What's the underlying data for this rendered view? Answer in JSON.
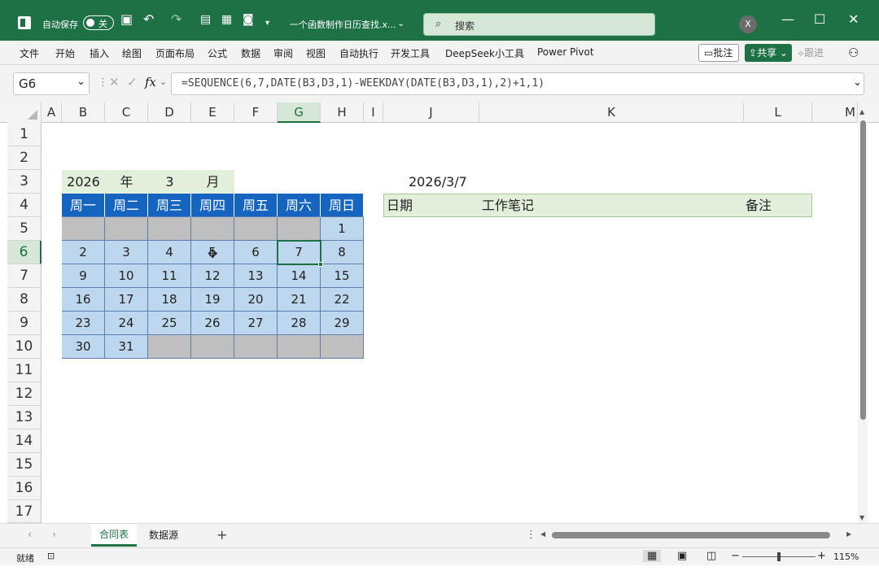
{
  "titlebar": {
    "autosave_label": "自动保存",
    "autosave_state": "关",
    "filename": "一个函数制作日历查找.x...",
    "search_placeholder": "搜索",
    "user_initial": "X"
  },
  "ribbon": {
    "tabs": [
      "文件",
      "开始",
      "插入",
      "绘图",
      "页面布局",
      "公式",
      "数据",
      "审阅",
      "视图",
      "自动执行",
      "开发工具",
      "DeepSeek小工具",
      "Power Pivot"
    ],
    "comment_label": "批注",
    "share_label": "共享",
    "track_label": "跟进"
  },
  "formula_bar": {
    "name_box": "G6",
    "fx_label": "fx",
    "formula": "=SEQUENCE(6,7,DATE(B3,D3,1)-WEEKDAY(DATE(B3,D3,1),2)+1,1)"
  },
  "columns": [
    "A",
    "B",
    "C",
    "D",
    "E",
    "F",
    "G",
    "H",
    "I",
    "J",
    "K",
    "L",
    "M"
  ],
  "selected_column": "G",
  "rows": [
    "1",
    "2",
    "3",
    "4",
    "5",
    "6",
    "7",
    "8",
    "9",
    "10",
    "11",
    "12",
    "13",
    "14",
    "15",
    "16",
    "17"
  ],
  "selected_row": "6",
  "calendar": {
    "year": "2026",
    "year_unit": "年",
    "month": "3",
    "month_unit": "月",
    "weekdays": [
      "周一",
      "周二",
      "周三",
      "周四",
      "周五",
      "周六",
      "周日"
    ],
    "weeks": [
      [
        "",
        "",
        "",
        "",
        "",
        "",
        "1"
      ],
      [
        "2",
        "3",
        "4",
        "5",
        "6",
        "7",
        "8"
      ],
      [
        "9",
        "10",
        "11",
        "12",
        "13",
        "14",
        "15"
      ],
      [
        "16",
        "17",
        "18",
        "19",
        "20",
        "21",
        "22"
      ],
      [
        "23",
        "24",
        "25",
        "26",
        "27",
        "28",
        "29"
      ],
      [
        "30",
        "31",
        "",
        "",
        "",
        "",
        ""
      ]
    ]
  },
  "notes": {
    "date_value": "2026/3/7",
    "col_date": "日期",
    "col_notes": "工作笔记",
    "col_remark": "备注"
  },
  "sheet_tabs": [
    "合同表",
    "数据源"
  ],
  "active_sheet": "合同表",
  "status": {
    "ready": "就绪",
    "zoom": "115%"
  },
  "colors": {
    "accent": "#1e7145",
    "header_blue": "#1565c0",
    "day_blue": "#bdd7ee",
    "empty_gray": "#bfbfbf",
    "light_green": "#e2efda"
  }
}
